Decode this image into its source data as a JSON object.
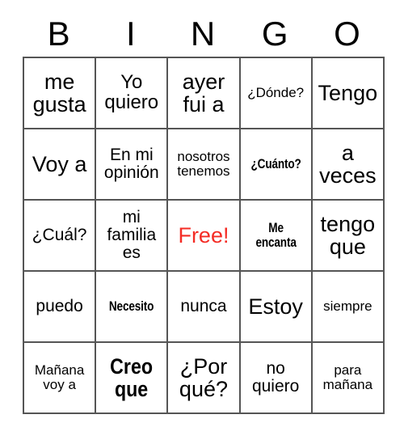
{
  "card": {
    "title_letters": [
      "B",
      "I",
      "N",
      "G",
      "O"
    ],
    "free_color": "#f42c25",
    "border_color": "#555555",
    "background_color": "#ffffff",
    "rows": [
      [
        {
          "text": "me gusta",
          "size": "s-xl",
          "style": "normal"
        },
        {
          "text": "Yo quiero",
          "size": "s-lg",
          "style": "normal"
        },
        {
          "text": "ayer fui a",
          "size": "s-xl",
          "style": "normal"
        },
        {
          "text": "¿Dónde?",
          "size": "s-sm",
          "style": "normal"
        },
        {
          "text": "Tengo",
          "size": "s-xl",
          "style": "normal"
        }
      ],
      [
        {
          "text": "Voy a",
          "size": "s-xl",
          "style": "normal"
        },
        {
          "text": "En mi opinión",
          "size": "s-md",
          "style": "normal"
        },
        {
          "text": "nosotros tenemos",
          "size": "s-sm",
          "style": "normal"
        },
        {
          "text": "¿Cuánto?",
          "size": "s-sm",
          "style": "bold-condensed"
        },
        {
          "text": "a veces",
          "size": "s-xl",
          "style": "normal"
        }
      ],
      [
        {
          "text": "¿Cuál?",
          "size": "s-md",
          "style": "normal"
        },
        {
          "text": "mi familia es",
          "size": "s-md",
          "style": "normal"
        },
        {
          "text": "Free!",
          "size": "s-xl",
          "style": "free"
        },
        {
          "text": "Me encanta",
          "size": "s-sm",
          "style": "bold-condensed"
        },
        {
          "text": "tengo que",
          "size": "s-xl",
          "style": "normal"
        }
      ],
      [
        {
          "text": "puedo",
          "size": "s-md",
          "style": "normal"
        },
        {
          "text": "Necesito",
          "size": "s-sm",
          "style": "bold-condensed"
        },
        {
          "text": "nunca",
          "size": "s-md",
          "style": "normal"
        },
        {
          "text": "Estoy",
          "size": "s-xl",
          "style": "normal"
        },
        {
          "text": "siempre",
          "size": "s-sm",
          "style": "normal"
        }
      ],
      [
        {
          "text": "Mañana voy a",
          "size": "s-sm",
          "style": "normal"
        },
        {
          "text": "Creo que",
          "size": "s-xl",
          "style": "bold-condensed-big"
        },
        {
          "text": "¿Por qué?",
          "size": "s-xl",
          "style": "normal"
        },
        {
          "text": "no quiero",
          "size": "s-md",
          "style": "normal"
        },
        {
          "text": "para mañana",
          "size": "s-sm",
          "style": "normal"
        }
      ]
    ]
  }
}
